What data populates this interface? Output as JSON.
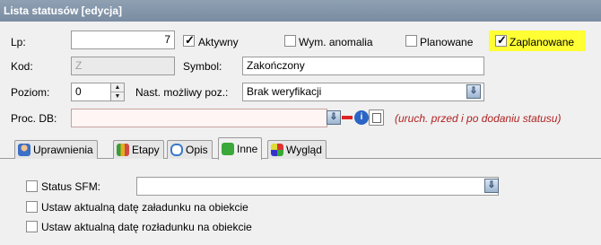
{
  "window": {
    "title": "Lista statusów [edycja]"
  },
  "form": {
    "lp": {
      "label": "Lp:",
      "value": "7"
    },
    "aktywny": {
      "label": "Aktywny",
      "checked": true
    },
    "wym_anomalia": {
      "label": "Wym. anomalia",
      "checked": false
    },
    "planowane": {
      "label": "Planowane",
      "checked": false
    },
    "zaplanowane": {
      "label": "Zaplanowane",
      "checked": true,
      "highlight_color": "#ffff33"
    },
    "kod": {
      "label": "Kod:",
      "value": "Z"
    },
    "symbol": {
      "label": "Symbol:",
      "value": "Zakończony"
    },
    "poziom": {
      "label": "Poziom:",
      "value": "0"
    },
    "nast_mozliwy": {
      "label": "Nast. możliwy poz.:",
      "value": "Brak weryfikacji"
    },
    "proc_db": {
      "label": "Proc. DB:",
      "value": "",
      "hint": "(uruch. przed i po dodaniu statusu)"
    }
  },
  "tabs": [
    {
      "label": "Uprawnienia",
      "icon": "user-icon"
    },
    {
      "label": "Etapy",
      "icon": "stages-icon"
    },
    {
      "label": "Opis",
      "icon": "speech-icon"
    },
    {
      "label": "Inne",
      "icon": "puzzle-icon",
      "active": true
    },
    {
      "label": "Wygląd",
      "icon": "palette-icon"
    }
  ],
  "inne": {
    "status_sfm": {
      "label": "Status SFM:",
      "checked": false,
      "value": ""
    },
    "zaladunek": {
      "label": "Ustaw aktualną datę załadunku na obiekcie",
      "checked": false
    },
    "rozladunek": {
      "label": "Ustaw aktualną datę rozładunku na obiekcie",
      "checked": false
    }
  },
  "colors": {
    "titlebar": "#7a8ca1",
    "hint": "#b22222",
    "highlight": "#ffff33"
  }
}
